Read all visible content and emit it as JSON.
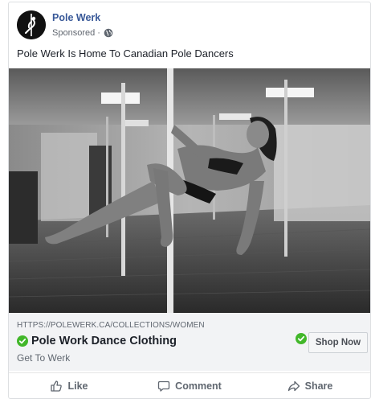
{
  "post": {
    "page_name": "Pole Werk",
    "sponsored_label": "Sponsored ·",
    "caption": "Pole Werk Is Home To Canadian Pole Dancers"
  },
  "link": {
    "url": "HTTPS://POLEWERK.CA/COLLECTIONS/WOMEN",
    "title": "Pole Work Dance Clothing",
    "description": "Get To Werk",
    "cta_label": "Shop Now"
  },
  "actions": {
    "like_label": "Like",
    "comment_label": "Comment",
    "share_label": "Share"
  },
  "colors": {
    "page_name": "#385898",
    "check_green": "#42b72a"
  },
  "icons": {
    "avatar": "pole-dancer-logo",
    "privacy": "globe-icon",
    "verified": "check-circle-icon",
    "like": "thumbs-up-icon",
    "comment": "speech-bubble-icon",
    "share": "share-arrow-icon"
  }
}
